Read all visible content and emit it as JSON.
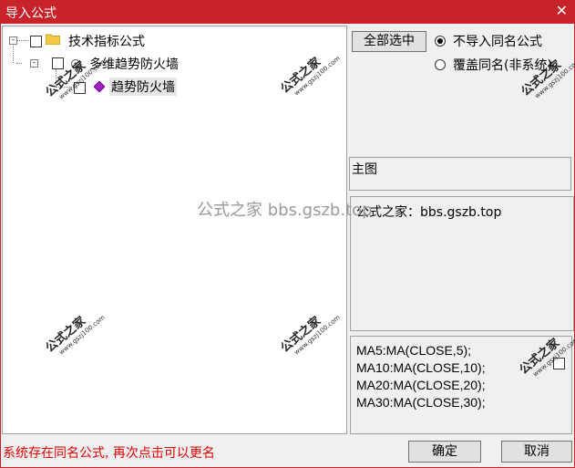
{
  "window": {
    "title": "导入公式",
    "close_glyph": "✕"
  },
  "tree": {
    "root": {
      "label": "技术指标公式",
      "expander": "-"
    },
    "child": {
      "label": "多维趋势防火墙",
      "expander": "-"
    },
    "leaf": {
      "label": "趋势防火墙"
    }
  },
  "options": {
    "select_all_label": "全部选中",
    "radio_skip_label": "不导入同名公式",
    "radio_overwrite_label": "覆盖同名(非系统)",
    "selected_radio": "skip"
  },
  "main_chart": {
    "label": "主图"
  },
  "description": {
    "text": "公式之家：bbs.gszb.top"
  },
  "code": {
    "lines": [
      "MA5:MA(CLOSE,5);",
      "MA10:MA(CLOSE,10);",
      "MA20:MA(CLOSE,20);",
      "MA30:MA(CLOSE,30);"
    ]
  },
  "footer": {
    "status": "系统存在同名公式, 再次点击可以更名",
    "ok_label": "确定",
    "cancel_label": "取消"
  },
  "watermarks": {
    "main": "公式之家",
    "url": "www.gszj100.com",
    "center": "公式之家 bbs.gszb.top"
  },
  "colors": {
    "titlebar": "#c8232a",
    "status_text": "#e00000"
  }
}
